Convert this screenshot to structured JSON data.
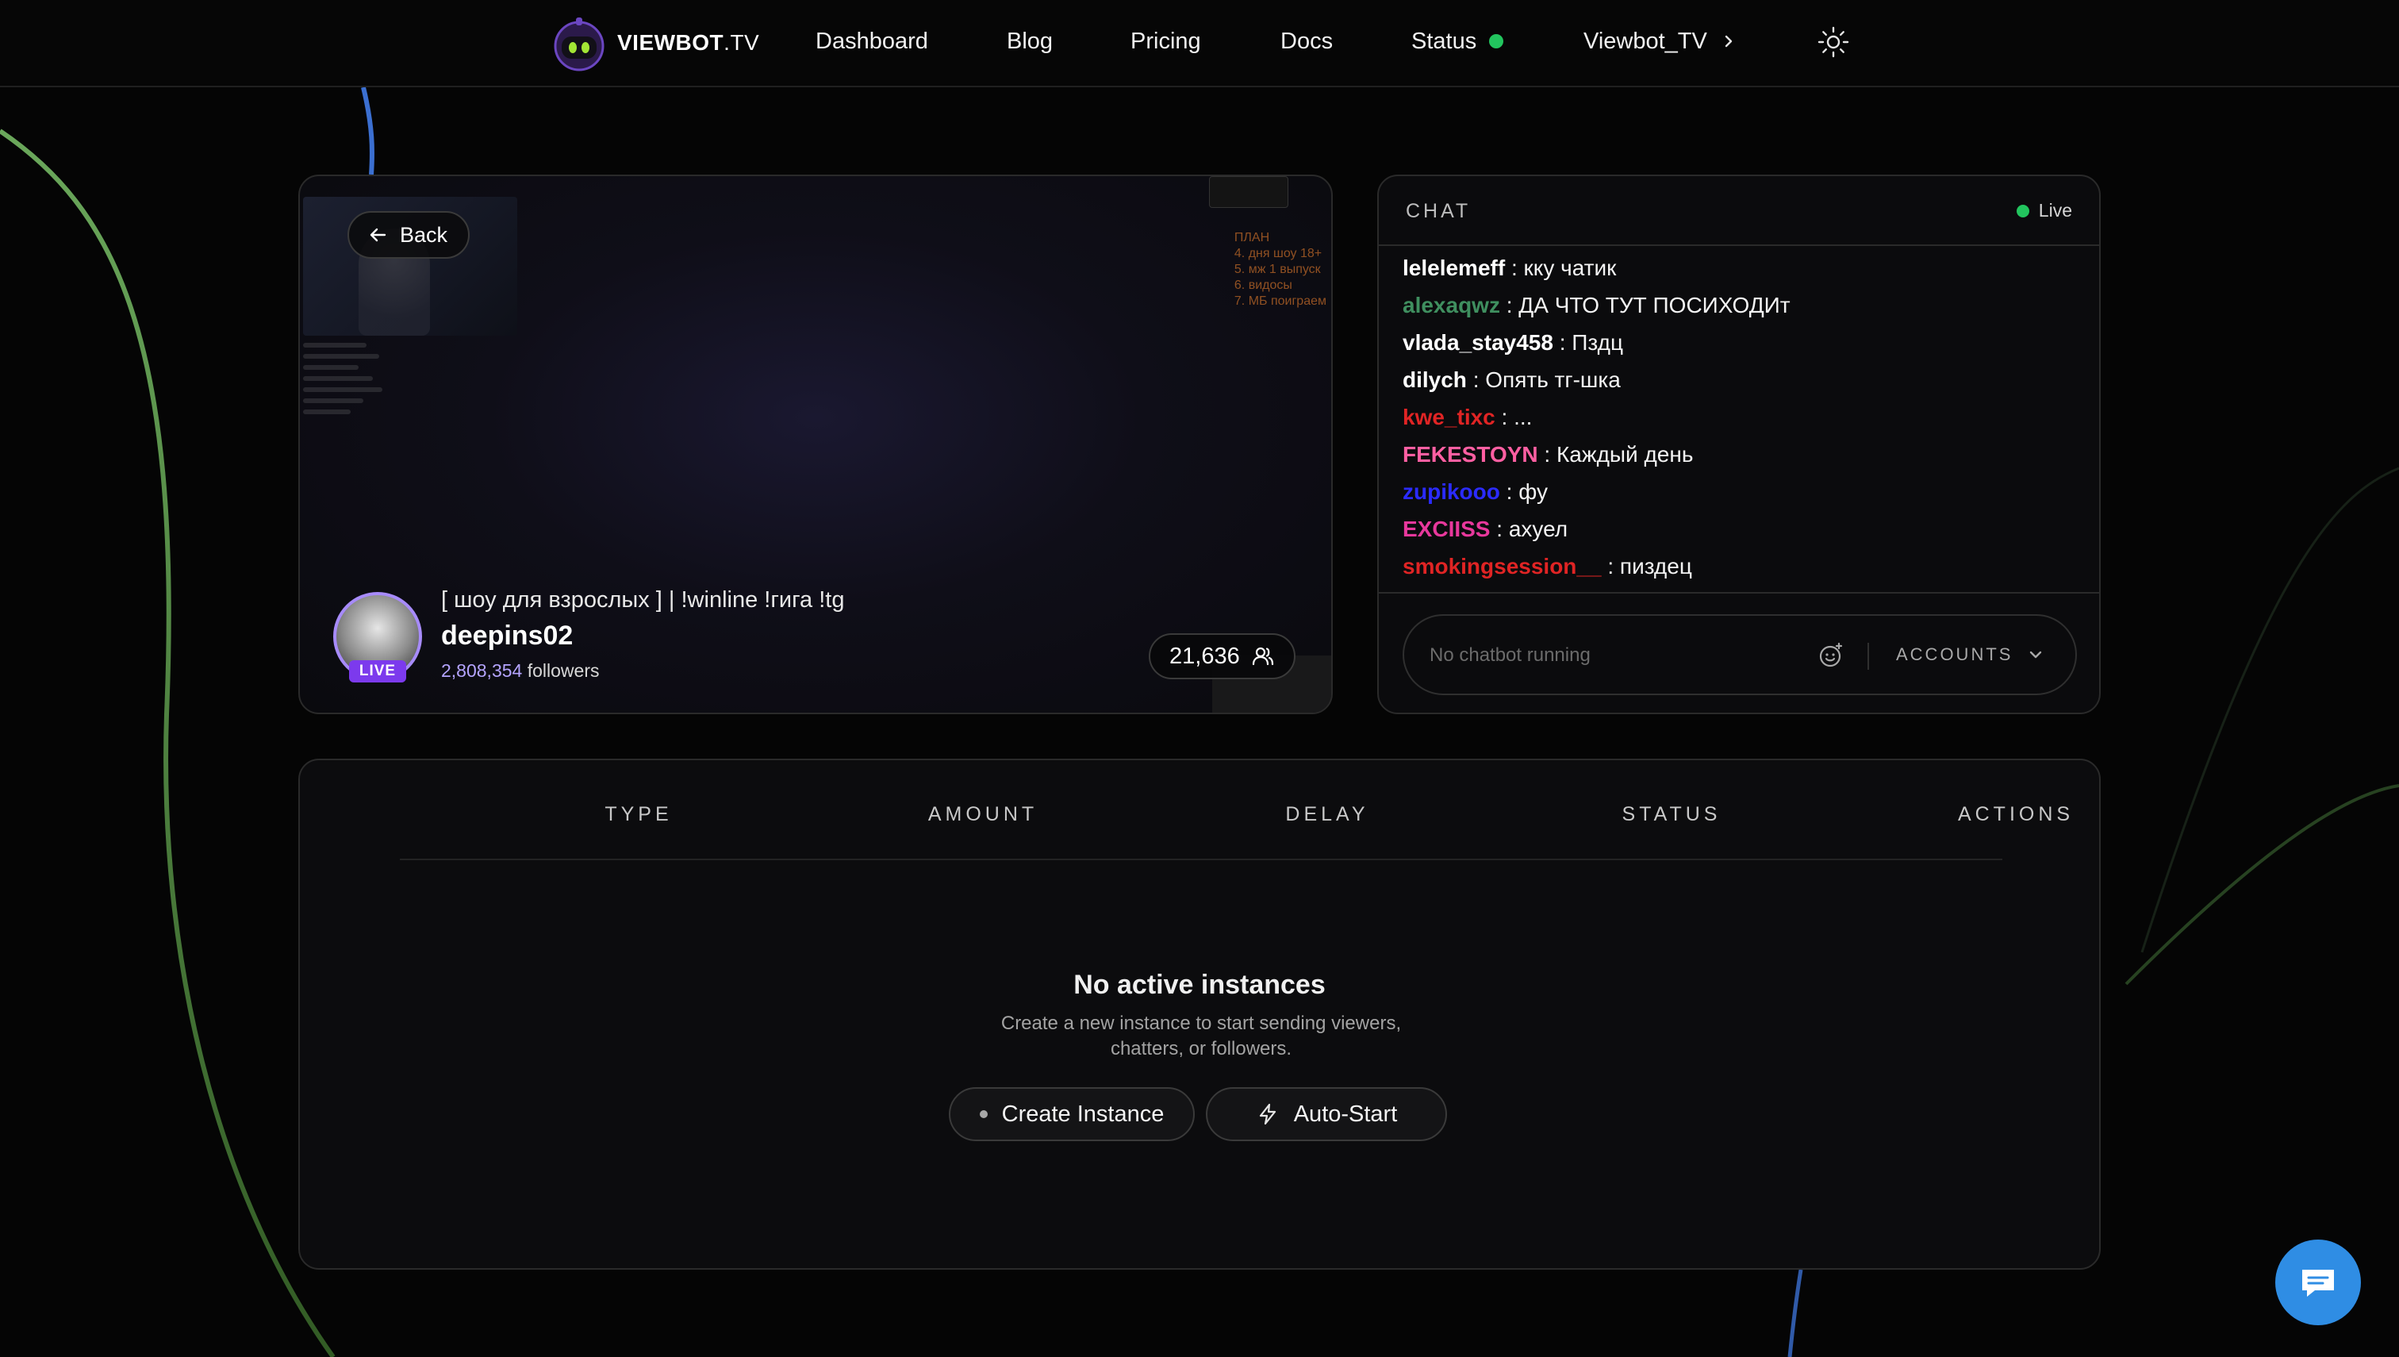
{
  "nav": {
    "brand_bold": "VIEWBOT",
    "brand_thin": ".TV",
    "links": [
      "Dashboard",
      "Blog",
      "Pricing",
      "Docs",
      "Status",
      "Viewbot_TV"
    ],
    "status_color": "#22c55e"
  },
  "stream": {
    "back_label": "Back",
    "live_badge": "LIVE",
    "title": "[ шоу для взрослых ] | !winline !гига !tg",
    "streamer": "deepins02",
    "followers_count": "2,808,354",
    "followers_label": "followers",
    "viewers": "21,636",
    "overlay_plan": [
      "ПЛАН",
      "4. дня шоу 18+",
      "5. мж 1 выпуск",
      "6. видосы",
      "7. МБ поиграем"
    ]
  },
  "chat": {
    "title": "CHAT",
    "live_label": "Live",
    "messages": [
      {
        "user": "lelelemeff",
        "color": "#ffffff",
        "text": ": кку чатик"
      },
      {
        "user": "alexaqwz",
        "color": "#3f8f5f",
        "text": ": ДА ЧТО ТУТ ПОСИХОДИт"
      },
      {
        "user": "vlada_stay458",
        "color": "#ffffff",
        "text": ": Пздц"
      },
      {
        "user": "dilych",
        "color": "#ffffff",
        "text": ": Опять тг-шка"
      },
      {
        "user": "kwe_tixc",
        "color": "#e02424",
        "text": ": ..."
      },
      {
        "user": "FEKESTOYN",
        "color": "#ff5fa2",
        "text": ": Каждый день"
      },
      {
        "user": "zupikooo",
        "color": "#2b2bff",
        "text": ": фу"
      },
      {
        "user": "EXCIISS",
        "color": "#e8389c",
        "text": ": ахуел"
      },
      {
        "user": "smokingsession__",
        "color": "#e02424",
        "text": ": пиздец"
      }
    ],
    "input_placeholder": "No chatbot running",
    "accounts_label": "ACCOUNTS"
  },
  "instances": {
    "columns": [
      "TYPE",
      "AMOUNT",
      "DELAY",
      "STATUS",
      "ACTIONS"
    ],
    "empty_title": "No active instances",
    "empty_subtitle": "Create a new instance to start sending viewers, chatters, or followers.",
    "create_label": "Create Instance",
    "auto_label": "Auto-Start"
  },
  "colors": {
    "accent_purple": "#7c3aed",
    "live_green": "#22c55e",
    "fab_blue": "#2f8de4"
  }
}
